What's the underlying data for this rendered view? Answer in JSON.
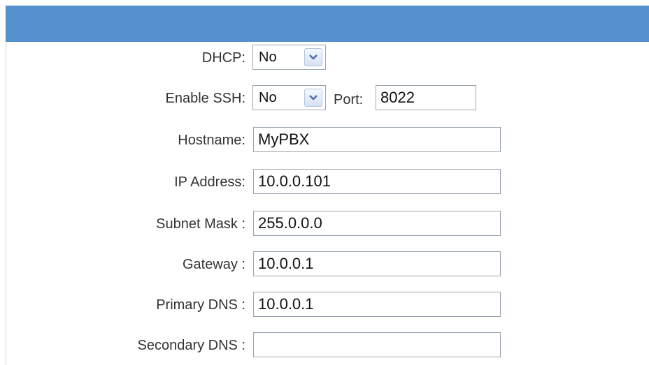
{
  "form": {
    "dhcp": {
      "label": "DHCP:",
      "selected": "No"
    },
    "ssh": {
      "label": "Enable SSH:",
      "selected": "No",
      "port_label": "Port:",
      "port_value": "8022"
    },
    "hostname": {
      "label": "Hostname:",
      "value": "MyPBX"
    },
    "ip_address": {
      "label": "IP Address:",
      "value": "10.0.0.101"
    },
    "subnet_mask": {
      "label": "Subnet Mask :",
      "value": "255.0.0.0"
    },
    "gateway": {
      "label": "Gateway :",
      "value": "10.0.0.1"
    },
    "primary_dns": {
      "label": "Primary DNS :",
      "value": "10.0.0.1"
    },
    "secondary_dns": {
      "label": "Secondary DNS :",
      "value": ""
    }
  },
  "colors": {
    "header": "#5591cc"
  },
  "icons": {
    "dropdown": "chevron-down-icon"
  }
}
